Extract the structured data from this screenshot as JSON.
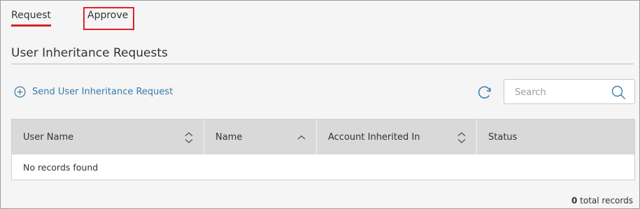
{
  "tabs": {
    "request": "Request",
    "approve": "Approve"
  },
  "page": {
    "title": "User Inheritance Requests"
  },
  "actions": {
    "send_request_label": "Send User Inheritance Request"
  },
  "search": {
    "placeholder": "Search",
    "value": ""
  },
  "table": {
    "columns": [
      "User Name",
      "Name",
      "Account Inherited In",
      "Status"
    ],
    "empty_message": "No records found"
  },
  "footer": {
    "total_count": "0",
    "total_suffix": "total records"
  },
  "colors": {
    "accent": "#d8232a",
    "link": "#3a7ba8",
    "highlight_box": "#e0202b",
    "header_bg": "#d9d9d9"
  },
  "icons": {
    "add": "plus-circle-icon",
    "refresh": "refresh-icon",
    "search": "search-icon",
    "sort_both": "sort-icon",
    "sort_asc": "sort-ascending-icon"
  }
}
